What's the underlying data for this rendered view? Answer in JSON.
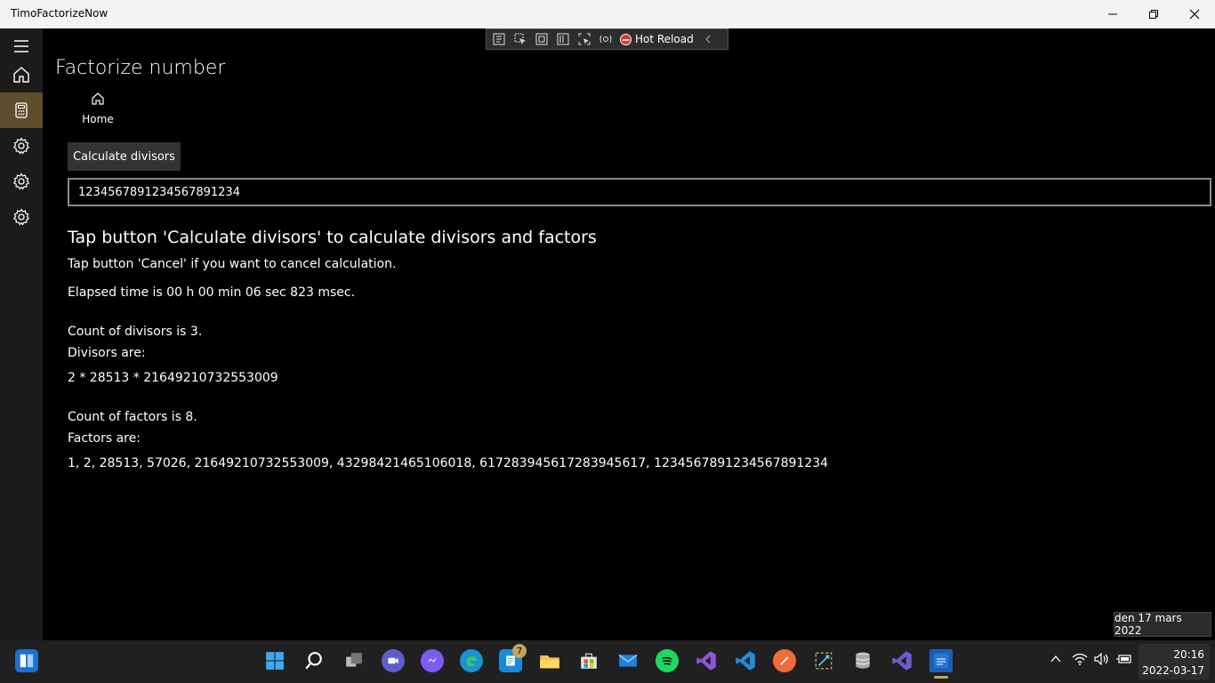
{
  "window": {
    "title": "TimoFactorizeNow"
  },
  "devtools": {
    "hot_reload_label": "Hot Reload"
  },
  "page": {
    "title": "Factorize number",
    "home_label": "Home",
    "calc_button_label": "Calculate divisors",
    "number_value": "1234567891234567891234",
    "instruction_heading": "Tap button 'Calculate divisors' to calculate divisors and factors",
    "cancel_hint": "Tap button 'Cancel' if you want to cancel calculation.",
    "elapsed": "Elapsed time is 00 h 00 min 06 sec 823 msec.",
    "divisor_count": "Count of divisors is 3.",
    "divisors_label": "Divisors are:",
    "divisors": "2 * 28513 * 21649210732553009",
    "factor_count": "Count of factors is 8.",
    "factors_label": "Factors are:",
    "factors": "1, 2, 28513, 57026, 21649210732553009, 43298421465106018, 617283945617283945617, 1234567891234567891234"
  },
  "tooltip": {
    "date_long": "den 17 mars 2022"
  },
  "taskbar": {
    "notification_badge": "7",
    "clock_time": "20:16",
    "clock_date": "2022-03-17"
  },
  "colors": {
    "accent": "#5e4d2f",
    "nav_background": "#1b1b1b",
    "taskbar_background": "#202020"
  }
}
